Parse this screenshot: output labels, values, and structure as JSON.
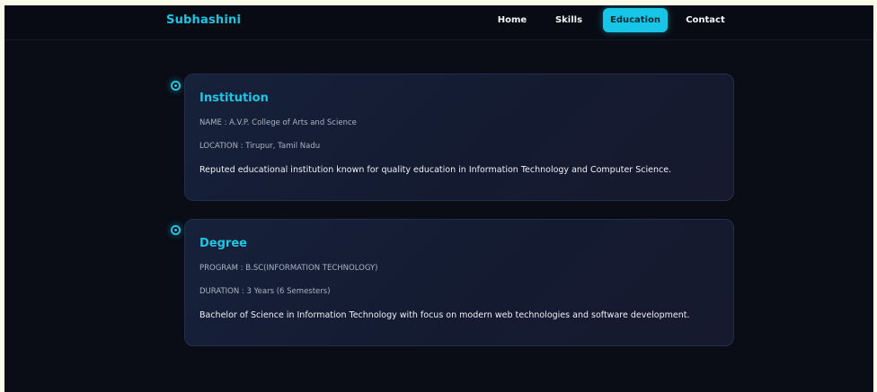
{
  "header": {
    "brand": "Subhashini",
    "nav": [
      "Home",
      "Skills",
      "Education",
      "Contact"
    ],
    "active_nav": "Education"
  },
  "education": [
    {
      "title": "Institution",
      "line1": "NAME : A.V.P. College of Arts and Science",
      "line2": "LOCATION : Tirupur, Tamil Nadu",
      "description": "Reputed educational institution known for quality education in Information Technology and Computer Science."
    },
    {
      "title": "Degree",
      "line1": "PROGRAM : B.SC(INFORMATION TECHNOLOGY)",
      "line2": "DURATION : 3 Years (6 Semesters)",
      "description": "Bachelor of Science in Information Technology with focus on modern web technologies and software development."
    }
  ],
  "colors": {
    "accent": "#17c5e6",
    "background": "#0a0c16",
    "card": "#16213a"
  }
}
